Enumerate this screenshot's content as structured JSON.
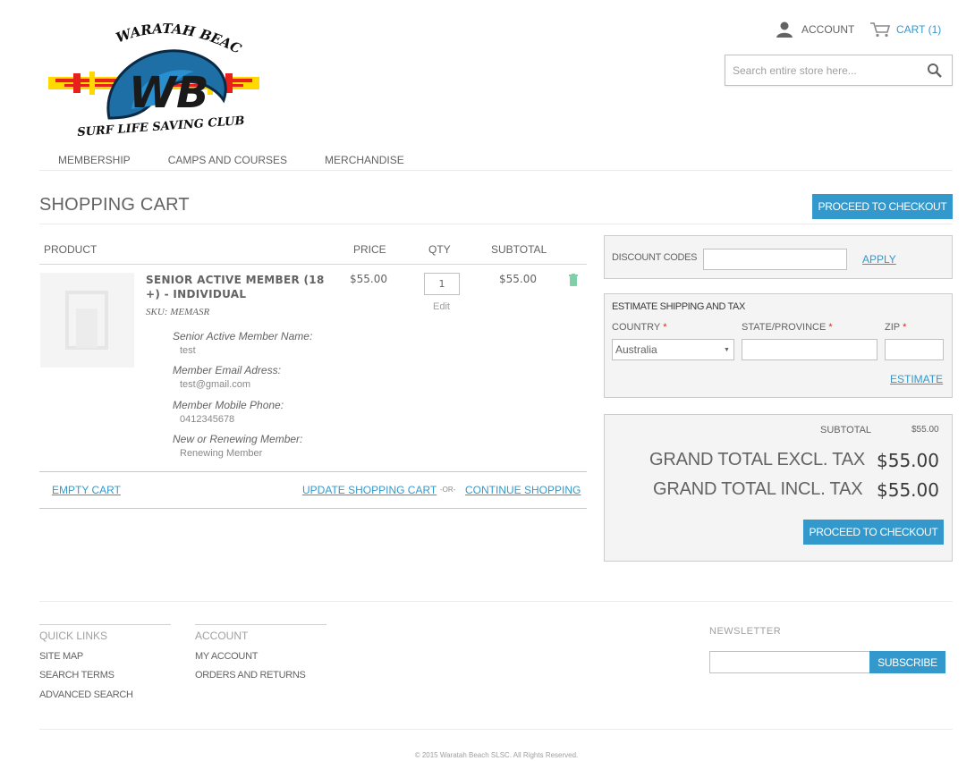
{
  "brand": {
    "logo_top_text": "WARATAH BEACH",
    "logo_mid_text": "WB",
    "logo_bottom_text": "SURF LIFE SAVING CLUB"
  },
  "header": {
    "account_label": "ACCOUNT",
    "cart_label": "CART (1)",
    "search_placeholder": "Search entire store here..."
  },
  "nav": {
    "items": [
      {
        "label": "MEMBERSHIP"
      },
      {
        "label": "CAMPS AND COURSES"
      },
      {
        "label": "MERCHANDISE"
      }
    ]
  },
  "page": {
    "title": "SHOPPING CART",
    "checkout_label": "PROCEED TO CHECKOUT"
  },
  "cart": {
    "columns": {
      "product": "PRODUCT",
      "price": "PRICE",
      "qty": "QTY",
      "subtotal": "SUBTOTAL"
    },
    "items": [
      {
        "name": "SENIOR ACTIVE MEMBER (18 +) - INDIVIDUAL",
        "sku": "SKU: MEMASR",
        "price": "$55.00",
        "qty": "1",
        "edit_label": "Edit",
        "subtotal": "$55.00",
        "options": [
          {
            "label": "Senior Active Member Name:",
            "value": "test"
          },
          {
            "label": "Member Email Adress:",
            "value": "test@gmail.com"
          },
          {
            "label": "Member Mobile Phone:",
            "value": "0412345678"
          },
          {
            "label": "New or Renewing Member:",
            "value": "Renewing Member"
          }
        ]
      }
    ],
    "empty_cart_label": "EMPTY CART",
    "update_cart_label": "UPDATE SHOPPING CART",
    "or_label": "-OR-",
    "continue_label": "CONTINUE SHOPPING"
  },
  "discount": {
    "label": "DISCOUNT CODES",
    "apply_label": "APPLY"
  },
  "shipping": {
    "title": "ESTIMATE SHIPPING AND TAX",
    "country_label": "COUNTRY",
    "country_value": "Australia",
    "state_label": "STATE/PROVINCE",
    "zip_label": "ZIP",
    "required_mark": "*",
    "estimate_label": "ESTIMATE"
  },
  "totals": {
    "subtotal_label": "SUBTOTAL",
    "subtotal_value": "$55.00",
    "grand_excl_label": "GRAND TOTAL EXCL. TAX",
    "grand_excl_value": "$55.00",
    "grand_incl_label": "GRAND TOTAL INCL. TAX",
    "grand_incl_value": "$55.00",
    "checkout_label": "PROCEED TO CHECKOUT"
  },
  "footer": {
    "quick_links_title": "QUICK LINKS",
    "quick_links": [
      "SITE MAP",
      "SEARCH TERMS",
      "ADVANCED SEARCH"
    ],
    "account_title": "ACCOUNT",
    "account_links": [
      "MY ACCOUNT",
      "ORDERS AND RETURNS"
    ],
    "newsletter_title": "NEWSLETTER",
    "subscribe_label": "SUBSCRIBE",
    "copyright": "© 2015 Waratah Beach SLSC. All Rights Reserved."
  },
  "colors": {
    "accent": "#3399cc",
    "text": "#636363",
    "panel_bg": "#f4f4f4",
    "required": "#df280a"
  }
}
